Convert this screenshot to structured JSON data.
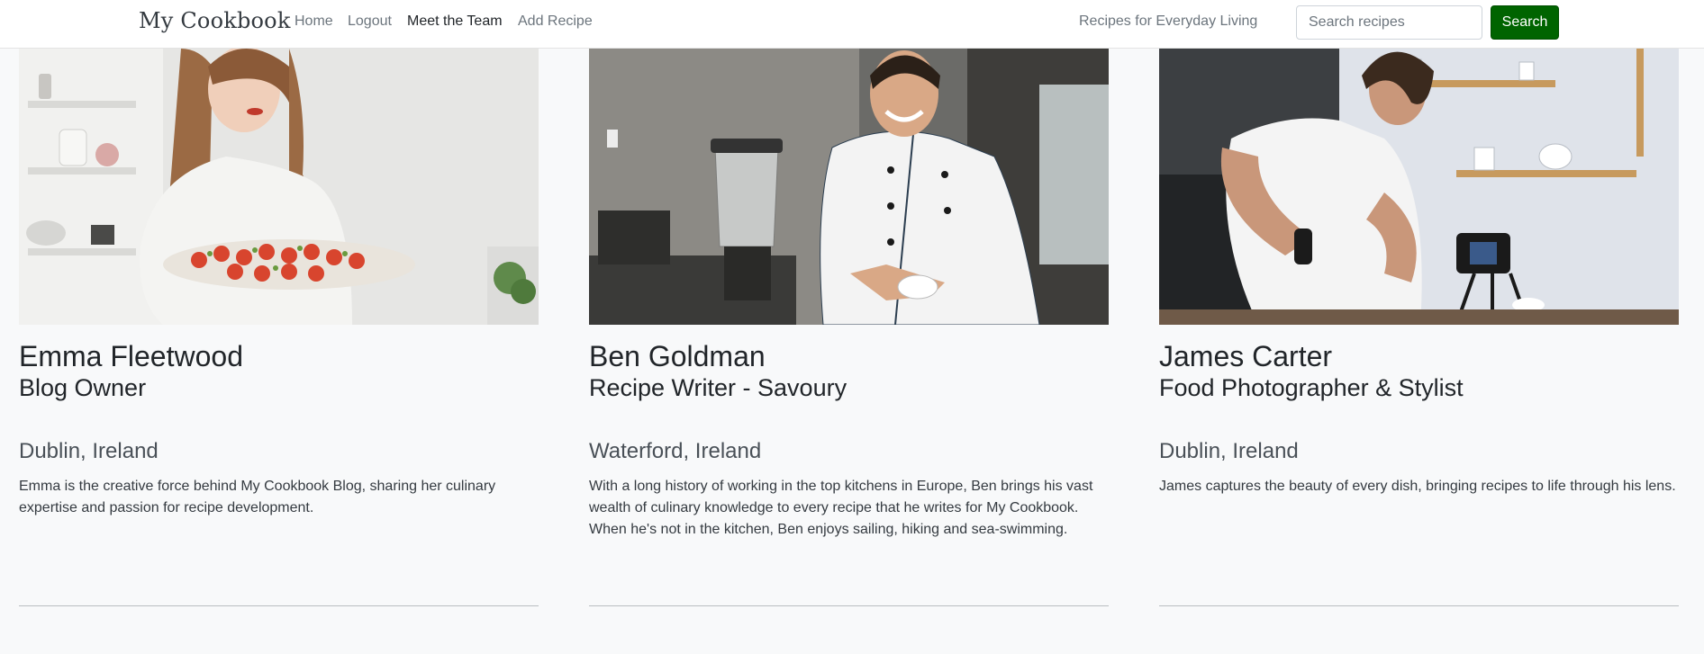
{
  "nav": {
    "brand": "My Cookbook",
    "links": [
      "Home",
      "Logout",
      "Meet the Team",
      "Add Recipe"
    ],
    "tagline": "Recipes for Everyday Living",
    "search_placeholder": "Search recipes",
    "search_button": "Search"
  },
  "team": [
    {
      "name": "Emma Fleetwood",
      "role": "Blog Owner",
      "location": "Dublin, Ireland",
      "bio": "Emma is the creative force behind My Cookbook Blog, sharing her culinary expertise and passion for recipe development."
    },
    {
      "name": "Ben Goldman",
      "role": "Recipe Writer - Savoury",
      "location": "Waterford, Ireland",
      "bio": "With a long history of working in the top kitchens in Europe, Ben brings his vast wealth of culinary knowledge to every recipe that he writes for My Cookbook. When he's not in the kitchen, Ben enjoys sailing, hiking and sea-swimming."
    },
    {
      "name": "James Carter",
      "role": "Food Photographer & Stylist",
      "location": "Dublin, Ireland",
      "bio": "James captures the beauty of every dish, bringing recipes to life through his lens."
    }
  ],
  "colors": {
    "search_button": "#006400",
    "page_background": "#f8f9fa"
  }
}
